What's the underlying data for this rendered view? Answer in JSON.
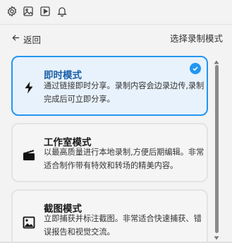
{
  "toolbar": {
    "icons": [
      "gear-icon",
      "image-icon",
      "video-icon",
      "bell-icon"
    ]
  },
  "nav": {
    "back_label": "返回",
    "title": "选择录制模式"
  },
  "modes": [
    {
      "icon": "lightning-icon",
      "title": "即时模式",
      "desc": "通过链接即时分享。录制内容会边录边传,录制完成后可立即分享。",
      "selected": true
    },
    {
      "icon": "clapperboard-icon",
      "title": "工作室模式",
      "desc": "以最高质量进行本地录制,方便后期编辑。非常适合制作带有特效和转场的精美内容。",
      "selected": false
    },
    {
      "icon": "picture-icon",
      "title": "截图模式",
      "desc": "立即捕获并标注截图。非常适合快速捕获、错误报告和视觉交流。",
      "selected": false
    }
  ],
  "colors": {
    "accent": "#2196f3",
    "selected_bg": "#e8f2fc",
    "card_bg": "#f5f5f5",
    "page_bg": "#f3f3f3"
  }
}
